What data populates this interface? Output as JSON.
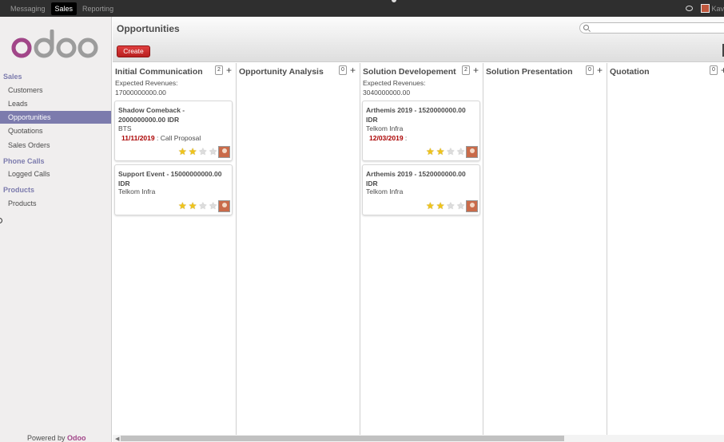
{
  "topbar": {
    "menu": [
      "Messaging",
      "Sales",
      "Reporting"
    ],
    "active_menu": "Sales",
    "user_name": "Kav"
  },
  "sidebar": {
    "logo_text": "odoo",
    "sections": [
      {
        "title": "Sales",
        "items": [
          "Customers",
          "Leads",
          "Opportunities",
          "Quotations",
          "Sales Orders"
        ]
      },
      {
        "title": "Phone Calls",
        "items": [
          "Logged Calls"
        ]
      },
      {
        "title": "Products",
        "items": [
          "Products"
        ]
      }
    ],
    "active_item": "Opportunities",
    "powered_by": "Powered by",
    "powered_brand": "Odoo"
  },
  "header": {
    "title": "Opportunities",
    "create_label": "Create",
    "search_placeholder": ""
  },
  "columns": [
    {
      "title": "Initial Communication",
      "count": "2",
      "plus": "+",
      "revenue_label": "Expected Revenues:",
      "revenue_value": "17000000000.00",
      "cards": [
        {
          "title": "Shadow Comeback - 2000000000.00 IDR",
          "partner": "BTS",
          "date": "11/11/2019",
          "action": " : Call Proposal",
          "stars": 2
        },
        {
          "title": "Support Event - 15000000000.00 IDR",
          "partner": "Telkom Infra",
          "stars": 2
        }
      ]
    },
    {
      "title": "Opportunity Analysis",
      "count": "0",
      "plus": "+",
      "cards": []
    },
    {
      "title": "Solution Developement",
      "count": "2",
      "plus": "+",
      "revenue_label": "Expected Revenues:",
      "revenue_value": "3040000000.00",
      "cards": [
        {
          "title": "Arthemis 2019 - 1520000000.00 IDR",
          "partner": "Telkom Infra",
          "date": "12/03/2019",
          "action": " :",
          "stars": 2
        },
        {
          "title": "Arthemis 2019 - 1520000000.00 IDR",
          "partner": "Telkom Infra",
          "stars": 2
        }
      ]
    },
    {
      "title": "Solution Presentation",
      "count": "0",
      "plus": "+",
      "cards": []
    },
    {
      "title": "Quotation",
      "count": "0",
      "plus": "+",
      "cards": []
    }
  ],
  "colors": {
    "brand": "#7c7bad",
    "create": "#c92a2a",
    "deadline": "#aa0000",
    "topbar": "#2f2f2f"
  }
}
